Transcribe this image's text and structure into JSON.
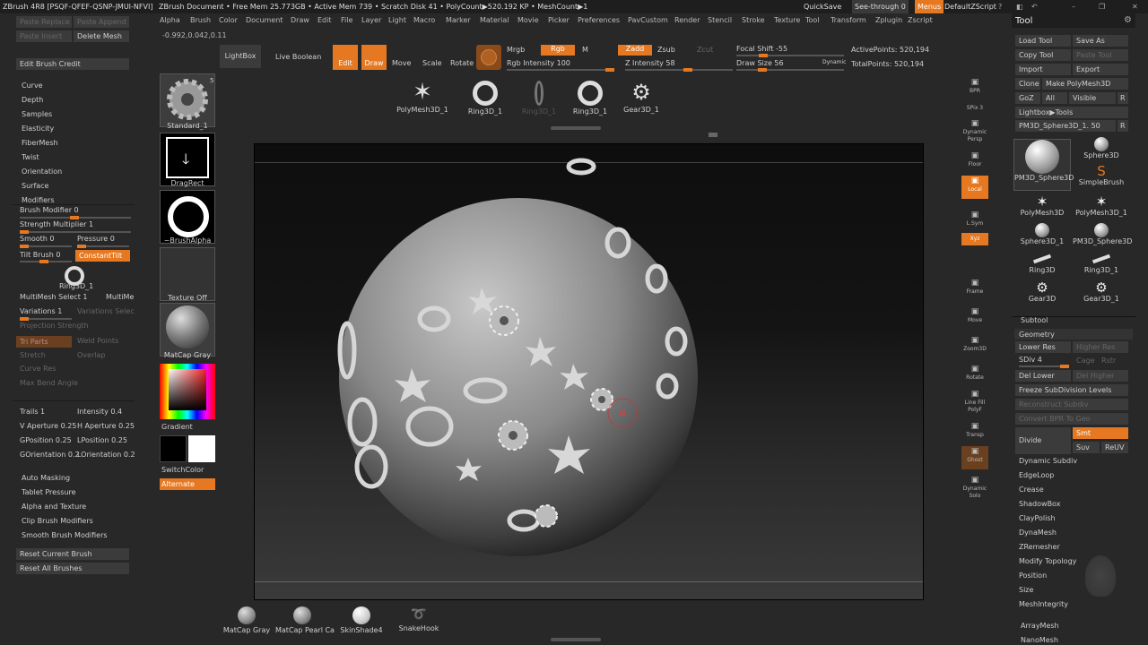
{
  "titlebar": {
    "app": "ZBrush 4R8 [PSQF-QFEF-QSNP-JMUI-NFVI]",
    "doc": "ZBrush Document",
    "stats": "• Free Mem 25.773GB • Active Mem 739 • Scratch Disk 41 • PolyCount▶520.192 KP • MeshCount▶1",
    "quicksave": "QuickSave",
    "seethrough": "See-through  0",
    "menus": "Menus",
    "script": "DefaultZScript"
  },
  "menu": [
    "Alpha",
    "Brush",
    "Color",
    "Document",
    "Draw",
    "Edit",
    "File",
    "Layer",
    "Light",
    "Macro",
    "Marker",
    "Material",
    "Movie",
    "Picker",
    "Preferences",
    "PavCustom",
    "Render",
    "Stencil",
    "Stroke",
    "Texture",
    "Tool",
    "Transform",
    "Zplugin",
    "Zscript"
  ],
  "coords": "-0.992,0.042,0.11",
  "left": {
    "paste_replace": "Paste Replace",
    "paste_append": "Paste Append",
    "paste_insert": "Paste Insert",
    "delete_mesh": "Delete Mesh",
    "edit_brush_credit": "Edit Brush Credit",
    "sections": [
      "Curve",
      "Depth",
      "Samples",
      "Elasticity",
      "FiberMesh",
      "Twist",
      "Orientation",
      "Surface",
      "Modifiers"
    ],
    "brush_modifier": "Brush Modifier 0",
    "strength_multiplier": "Strength Multiplier 1",
    "smooth": "Smooth 0",
    "pressure": "Pressure 0",
    "tilt_brush": "Tilt Brush 0",
    "constant_tilt": "ConstantTilt",
    "ring_label": "Ring3D_1",
    "multimesh_select": "MultiMesh Select 1",
    "multime": "MultiMe",
    "variations": "Variations 1",
    "variations_selec": "Variations Selec",
    "projection_strength": "Projection Strength",
    "tri_parts": "Tri Parts",
    "weld_points": "Weld Points",
    "stretch": "Stretch",
    "overlap": "Overlap",
    "curve_res": "Curve Res",
    "max_bend_angle": "Max Bend Angle",
    "trails": "Trails 1",
    "intensity": "Intensity 0.4",
    "v_aperture": "V Aperture 0.25",
    "h_aperture": "H Aperture 0.25",
    "gposition": "GPosition 0.25",
    "lposition": "LPosition 0.25",
    "gorientation": "GOrientation 0.2",
    "lorientation": "LOrientation 0.2",
    "sections2": [
      "Auto Masking",
      "Tablet Pressure",
      "Alpha and Texture",
      "Clip Brush Modifiers",
      "Smooth Brush Modifiers"
    ],
    "reset_current": "Reset Current Brush",
    "reset_all": "Reset All Brushes"
  },
  "previews": {
    "brush": "Standard_1",
    "brush_count": "5",
    "stroke": "DragRect",
    "alpha": "~BrushAlpha",
    "texture": "Texture Off",
    "material": "MatCap Gray",
    "gradient": "Gradient",
    "switch": "SwitchColor",
    "alternate": "Alternate"
  },
  "toptool": {
    "lightbox": "LightBox",
    "live_boolean": "Live Boolean",
    "edit": "Edit",
    "draw": "Draw",
    "move": "Move",
    "scale": "Scale",
    "rotate": "Rotate",
    "mrgb": "Mrgb",
    "rgb": "Rgb",
    "m": "M",
    "zadd": "Zadd",
    "zsub": "Zsub",
    "zcut": "Zcut",
    "rgb_intensity": "Rgb Intensity 100",
    "z_intensity": "Z Intensity 58",
    "focal_shift": "Focal Shift -55",
    "draw_size": "Draw Size 56",
    "dynamic": "Dynamic",
    "active_points": "ActivePoints: 520,194",
    "total_points": "TotalPoints: 520,194",
    "insert_meshes": [
      "PolyMesh3D_1",
      "Ring3D_1",
      "Ring3D_1",
      "Ring3D_1",
      "Gear3D_1"
    ]
  },
  "rightshelf": [
    "BPR",
    "SPix 3",
    "Dynamic Persp",
    "Floor",
    "Local",
    "L.Sym",
    "Xyz",
    "",
    "",
    "Frame",
    "Move",
    "Zoom3D",
    "Rotate",
    "Line Fill PolyF",
    "Transp",
    "Ghost",
    "Dynamic Solo"
  ],
  "tool": {
    "title": "Tool",
    "load": "Load Tool",
    "save_as": "Save As",
    "copy": "Copy Tool",
    "paste": "Paste Tool",
    "import": "Import",
    "export": "Export",
    "clone": "Clone",
    "make_polymesh": "Make PolyMesh3D",
    "goz": "GoZ",
    "all": "All",
    "visible": "Visible",
    "r": "R",
    "lightbox_tools": "Lightbox▶Tools",
    "current": "PM3D_Sphere3D_1. 50",
    "thumbs": [
      "PM3D_Sphere3D",
      "Sphere3D",
      "SimpleBrush",
      "PolyMesh3D",
      "PolyMesh3D_1",
      "Sphere3D_1",
      "PM3D_Sphere3D",
      "Ring3D",
      "Ring3D_1",
      "Gear3D",
      "Gear3D_1"
    ],
    "subtool": "Subtool",
    "geometry": "Geometry",
    "lower_res": "Lower Res",
    "higher_res": "Higher Res",
    "sdiv": "SDiv 4",
    "cage": "Cage",
    "rstr": "Rstr",
    "del_lower": "Del Lower",
    "del_higher": "Del Higher",
    "freeze": "Freeze SubDivision Levels",
    "reconstruct": "Reconstruct Subdiv",
    "convert_bpr": "Convert BPR To Geo",
    "divide": "Divide",
    "smt": "Smt",
    "suv": "Suv",
    "reuv": "ReUV",
    "items": [
      "Dynamic Subdiv",
      "EdgeLoop",
      "Crease",
      "ShadowBox",
      "ClayPolish",
      "DynaMesh",
      "ZRemesher",
      "Modify Topology",
      "Position",
      "Size",
      "MeshIntegrity"
    ],
    "arraymesh": "ArrayMesh",
    "nanomesh": "NanoMesh"
  },
  "bottom": [
    "MatCap Gray",
    "MatCap Pearl Ca",
    "SkinShade4",
    "SnakeHook"
  ],
  "colors": {
    "accent": "#e57820",
    "panel": "#282828",
    "button": "#3b3b3b"
  }
}
